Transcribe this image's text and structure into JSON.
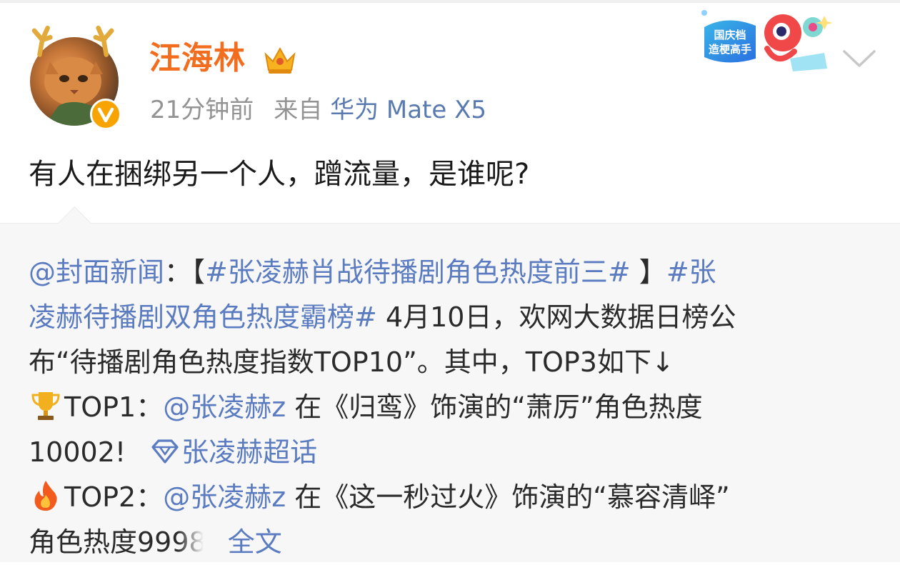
{
  "post": {
    "username": "汪海林",
    "time": "21分钟前",
    "source_prefix": "来自",
    "device": "华为 Mate X5",
    "text": "有人在捆绑另一个人，蹭流量，是谁呢?",
    "badge_text_1": "国庆档",
    "badge_text_2": "造梗高手"
  },
  "repost": {
    "l1_mention": "@封面新闻",
    "l1_colon": "：【",
    "l1_tag": "#张凌赫肖战待播剧角色热度前三#",
    "l1_bracket": " 】",
    "l1_tag2a": "#张",
    "l2_tag2b": "凌赫待播剧双角色热度霸榜#",
    "l2_text": " 4月10日，欢网大数据日榜公",
    "l3_text": "布“待播剧角色热度指数TOP10”。其中，TOP3如下↓",
    "l4_prefix": "TOP1：",
    "l4_mention": "@张凌赫z",
    "l4_text": " 在《归鸾》饰演的“萧厉”角色热度",
    "l5_text": "10002!",
    "l5_supertopic": "张凌赫超话",
    "l6_prefix": "TOP2：",
    "l6_mention": "@张凌赫z",
    "l6_text": " 在《这一秒过火》饰演的“慕容清峄”",
    "l7_text": "角色热度9998",
    "l7_more": "全文"
  },
  "icons": {
    "verified": "verified-v-icon",
    "crown": "vip-crown-icon",
    "chevron": "chevron-down-icon",
    "trophy": "trophy-icon",
    "fire": "fire-icon",
    "diamond": "super-topic-diamond-icon"
  },
  "colors": {
    "username": "#f36d1f",
    "link": "#5b7cc0",
    "meta": "#939393",
    "repost_bg": "#f7f7f7"
  }
}
